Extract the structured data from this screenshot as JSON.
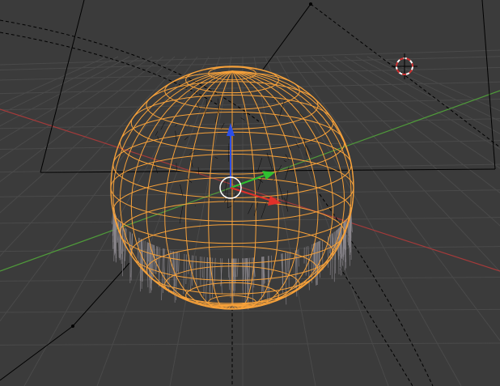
{
  "viewport": {
    "mode": "wireframe",
    "view": "perspective"
  },
  "scene": {
    "selected_object": "sphere",
    "selection_state": "selected",
    "has_hair_particles": true,
    "has_camera": true,
    "has_lamp": true,
    "has_3d_cursor": true,
    "transform_manipulator": "translate"
  },
  "colors": {
    "background": "#3b3b3b",
    "grid": "#4a4a4a",
    "grid_major": "#555555",
    "x_axis": "#a33a3a",
    "y_axis": "#4f9a3a",
    "selected_wire": "#f6a13a",
    "hair": "#8e8a90",
    "object_wire": "#000000",
    "manipulator_x": "#e0302a",
    "manipulator_y": "#2fc02f",
    "manipulator_z": "#2c4fe8",
    "cursor_ring": "#ffffff",
    "cursor_dash": "#d03030"
  }
}
